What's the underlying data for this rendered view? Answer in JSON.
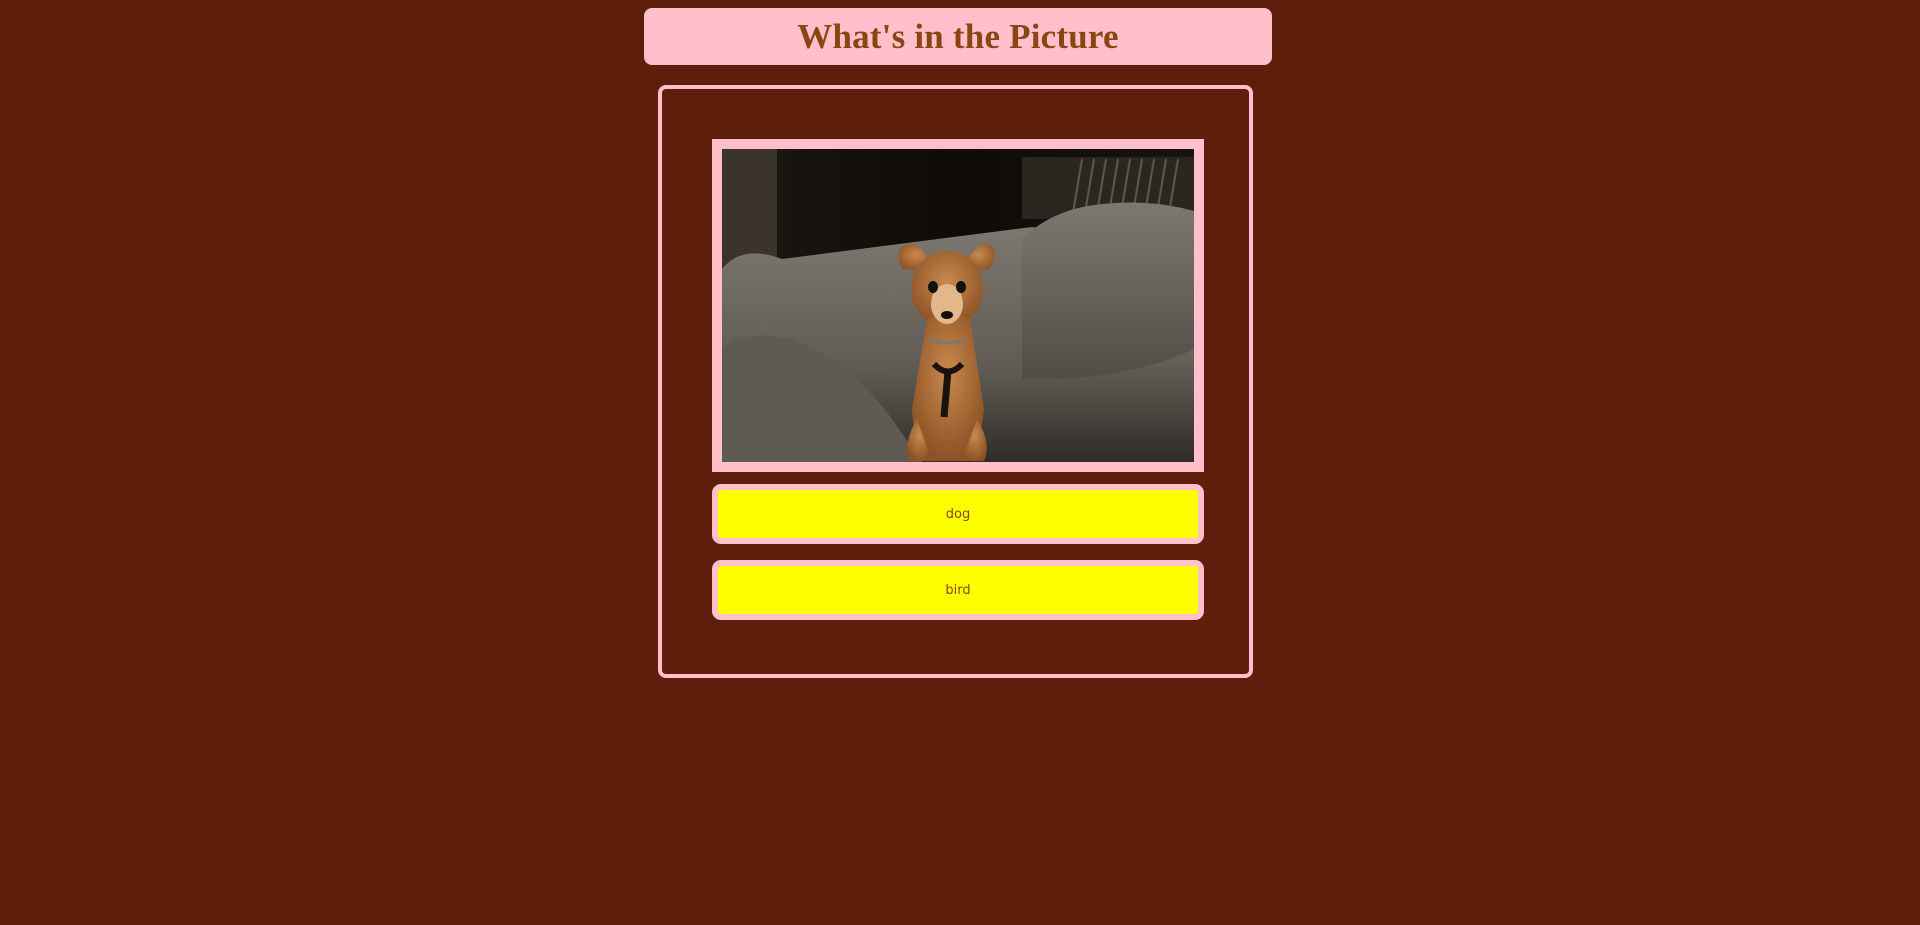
{
  "header": {
    "title": "What's in the Picture"
  },
  "quiz": {
    "image_subject": "small tan dog sitting on a gray couch",
    "answers": [
      {
        "label": "dog"
      },
      {
        "label": "bird"
      }
    ]
  },
  "colors": {
    "background": "#5e1e0b",
    "accent_pink": "#ffc0cb",
    "answer_yellow": "#ffff00",
    "text_brown": "#8b4513"
  }
}
